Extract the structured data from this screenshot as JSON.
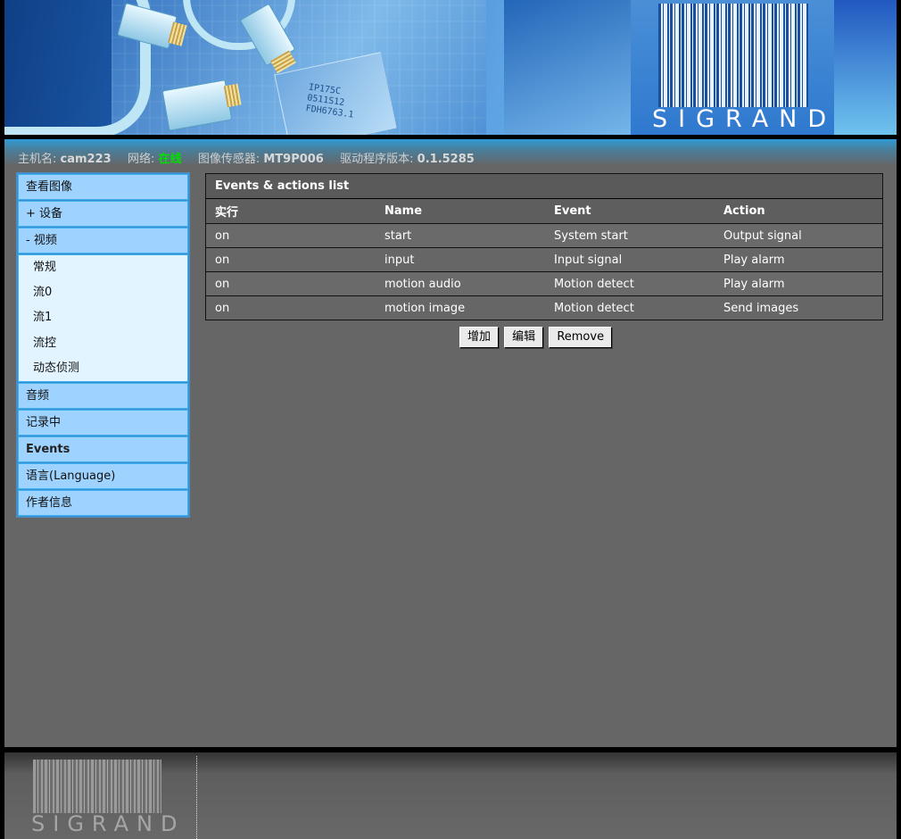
{
  "header": {
    "brand": "SIGRAND",
    "chip_text": "IP175C\n0511S12\nFDH6763.1"
  },
  "status": {
    "hostname_label": "主机名:",
    "hostname": "cam223",
    "network_label": "网络:",
    "network": "在线",
    "sensor_label": "图像传感器:",
    "sensor": "MT9P006",
    "driver_label": "驱动程序版本:",
    "driver": "0.1.5285"
  },
  "sidebar": {
    "items": [
      {
        "label": "查看图像"
      },
      {
        "label": "+ 设备"
      },
      {
        "label": "- 视频"
      }
    ],
    "video_sub": [
      {
        "label": "常规"
      },
      {
        "label": "流0"
      },
      {
        "label": "流1"
      },
      {
        "label": "流控"
      },
      {
        "label": "动态侦测"
      }
    ],
    "items_after": [
      {
        "label": "音频"
      },
      {
        "label": "记录中"
      },
      {
        "label": "Events",
        "active": true
      },
      {
        "label": "语言(Language)"
      },
      {
        "label": "作者信息"
      }
    ]
  },
  "events": {
    "title": "Events & actions list",
    "columns": [
      "实行",
      "Name",
      "Event",
      "Action"
    ],
    "rows": [
      [
        "on",
        "start",
        "System start",
        "Output signal"
      ],
      [
        "on",
        "input",
        "Input signal",
        "Play alarm"
      ],
      [
        "on",
        "motion audio",
        "Motion detect",
        "Play alarm"
      ],
      [
        "on",
        "motion image",
        "Motion detect",
        "Send images"
      ]
    ],
    "buttons": {
      "add": "增加",
      "edit": "编辑",
      "remove": "Remove"
    }
  },
  "footer": {
    "brand": "SIGRAND"
  },
  "colors": {
    "online": "#00e000",
    "nav_bg": "#9fd3ff",
    "sub_bg": "#e2f4ff",
    "panel_bg": "#666666"
  }
}
